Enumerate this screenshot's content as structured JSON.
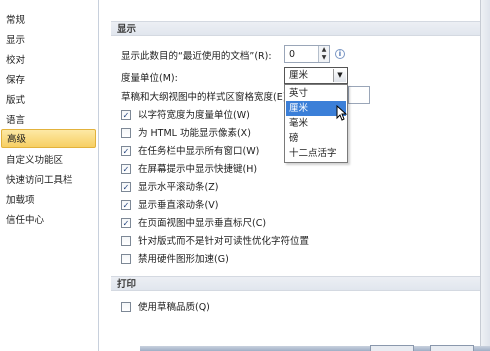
{
  "nav": {
    "items": [
      {
        "label": "常规"
      },
      {
        "label": "显示"
      },
      {
        "label": "校对"
      },
      {
        "label": "保存"
      },
      {
        "label": "版式"
      },
      {
        "label": "语言"
      },
      {
        "label": "高级"
      },
      {
        "label": "自定义功能区"
      },
      {
        "label": "快速访问工具栏"
      },
      {
        "label": "加载项"
      },
      {
        "label": "信任中心"
      }
    ],
    "selected": "高级"
  },
  "display_section": {
    "header": "显示",
    "recent_docs_label": "显示此数目的“最近使用的文档”(R):",
    "recent_docs_value": "0",
    "unit_label": "度量单位(M):",
    "unit_value": "厘米",
    "style_width_label": "草稿和大纲视图中的样式区窗格宽度(E):",
    "unit_options": [
      "英寸",
      "厘米",
      "毫米",
      "磅",
      "十二点活字"
    ],
    "unit_selected": "厘米",
    "checkboxes": [
      {
        "label": "以字符宽度为度量单位(W)",
        "checked": true
      },
      {
        "label": "为 HTML 功能显示像素(X)",
        "checked": false
      },
      {
        "label": "在任务栏中显示所有窗口(W)",
        "checked": true
      },
      {
        "label": "在屏幕提示中显示快捷键(H)",
        "checked": true
      },
      {
        "label": "显示水平滚动条(Z)",
        "checked": true
      },
      {
        "label": "显示垂直滚动条(V)",
        "checked": true
      },
      {
        "label": "在页面视图中显示垂直标尺(C)",
        "checked": true
      },
      {
        "label": "针对版式而不是针对可读性优化字符位置",
        "checked": false
      },
      {
        "label": "禁用硬件图形加速(G)",
        "checked": false
      }
    ]
  },
  "print_section": {
    "header": "打印",
    "checkboxes": [
      {
        "label": "使用草稿品质(Q)",
        "checked": false
      }
    ]
  },
  "icons": {
    "check": "✓",
    "up": "▲",
    "down": "▼",
    "info": "i"
  },
  "colors": {
    "nav_selected": "#f7cf63",
    "dropdown_selected": "#3b7fd8"
  }
}
